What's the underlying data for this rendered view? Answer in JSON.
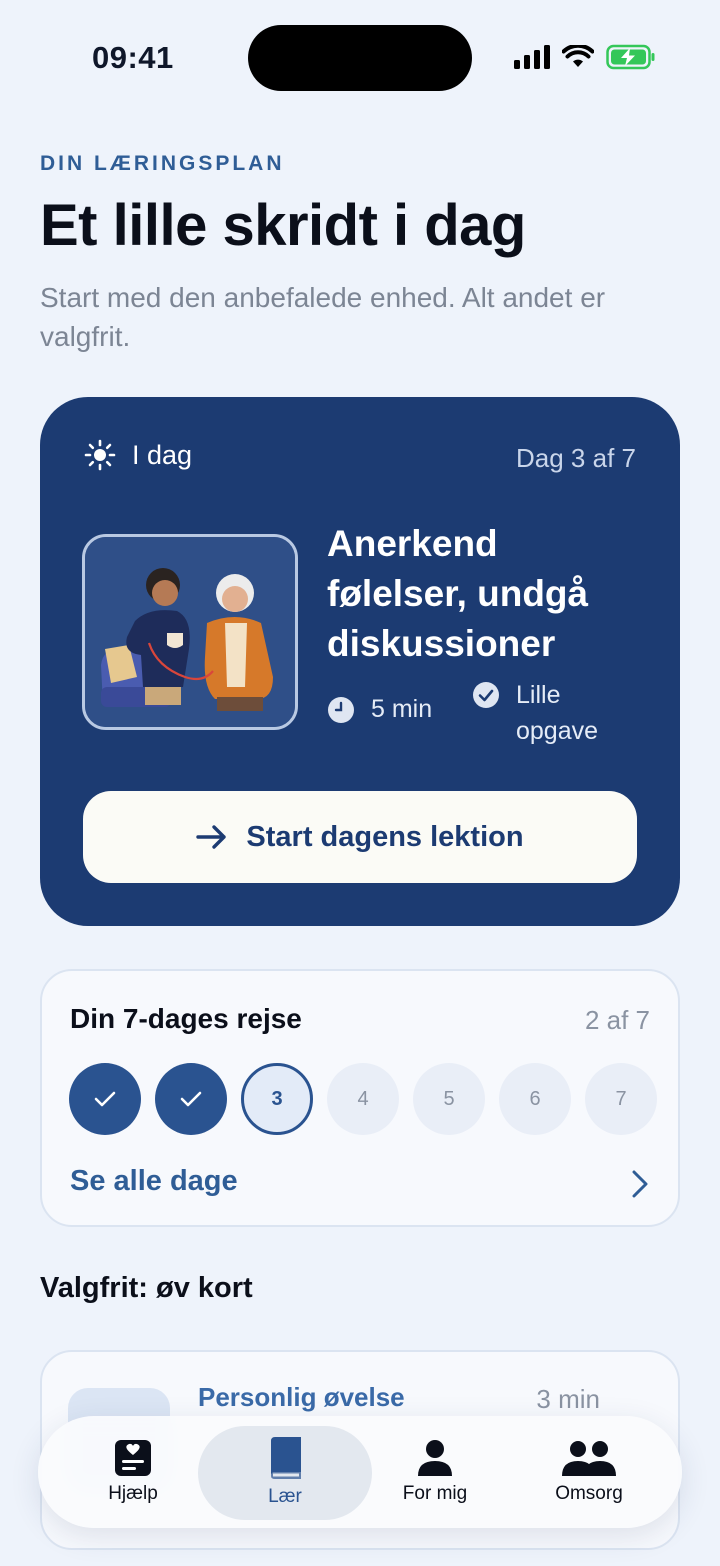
{
  "status_bar": {
    "time": "09:41"
  },
  "header": {
    "eyebrow": "DIN LÆRINGSPLAN",
    "title": "Et lille skridt i dag",
    "subtitle": "Start med den anbefalede enhed. Alt andet er valgfrit."
  },
  "today": {
    "label": "I dag",
    "day_counter": "Dag 3 af 7",
    "lesson_title": "Anerkend følelser, undgå diskussioner",
    "duration": "5 min",
    "task": "Lille opgave",
    "start_button": "Start dagens lektion"
  },
  "journey": {
    "title": "Din 7-dages rejse",
    "progress": "2 af 7",
    "days": [
      {
        "label": "",
        "state": "done"
      },
      {
        "label": "",
        "state": "done"
      },
      {
        "label": "3",
        "state": "current"
      },
      {
        "label": "4",
        "state": "upcoming"
      },
      {
        "label": "5",
        "state": "upcoming"
      },
      {
        "label": "6",
        "state": "upcoming"
      },
      {
        "label": "7",
        "state": "upcoming"
      }
    ],
    "see_all": "Se alle dage"
  },
  "optional": {
    "heading": "Valgfrit: øv kort",
    "practice_title": "Personlig øvelse",
    "practice_duration": "3 min"
  },
  "tabs": [
    {
      "label": "Hjælp",
      "icon": "help-card-icon"
    },
    {
      "label": "Lær",
      "icon": "book-icon",
      "active": true
    },
    {
      "label": "For mig",
      "icon": "person-icon"
    },
    {
      "label": "Omsorg",
      "icon": "people-icon"
    }
  ],
  "colors": {
    "primary": "#1c3b72",
    "accent": "#2f5d96",
    "background": "#eef3fb",
    "battery": "#34c759"
  }
}
